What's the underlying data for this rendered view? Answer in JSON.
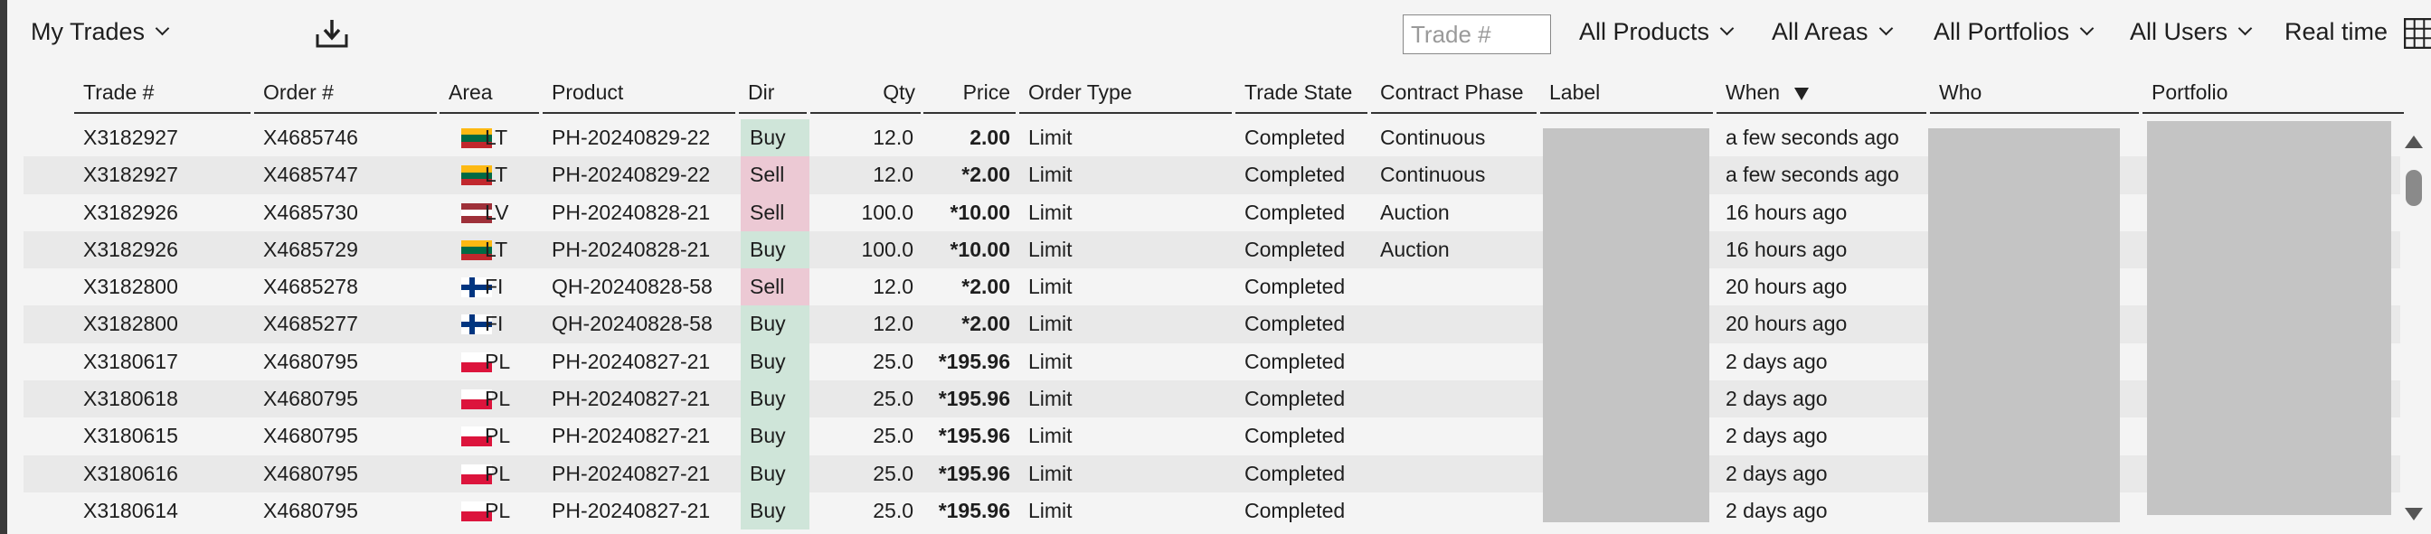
{
  "toolbar": {
    "title": "My Trades",
    "download_icon": "download-icon",
    "search_placeholder": "Trade #",
    "filters": [
      "All Products",
      "All Areas",
      "All Portfolios",
      "All Users"
    ],
    "realtime_label": "Real time",
    "grid_icon": "grid-settings-icon"
  },
  "columns": [
    "Trade #",
    "Order #",
    "Area",
    "Product",
    "Dir",
    "Qty",
    "Price",
    "Order Type",
    "Trade State",
    "Contract Phase",
    "Label",
    "When",
    "Who",
    "Portfolio"
  ],
  "sorted_column": "When",
  "sort_direction": "descending",
  "colors": {
    "buy_bg": "#cfe5d9",
    "sell_bg": "#ecc9d4",
    "header_rule": "#333333"
  },
  "flags": {
    "LT": [
      "#fdb913",
      "#006a44",
      "#c1272d"
    ],
    "LV": [
      "#9e3039",
      "#ffffff",
      "#9e3039"
    ],
    "FI": "white-with-blue-cross",
    "PL": [
      "#ffffff",
      "#dc143c"
    ]
  },
  "rows": [
    {
      "trade": "X3182927",
      "order": "X4685746",
      "area": "LT",
      "product": "PH-20240829-22",
      "dir": "Buy",
      "qty": "12.0",
      "price": "2.00",
      "order_type": "Limit",
      "state": "Completed",
      "phase": "Continuous",
      "when": "a few seconds ago"
    },
    {
      "trade": "X3182927",
      "order": "X4685747",
      "area": "LT",
      "product": "PH-20240829-22",
      "dir": "Sell",
      "qty": "12.0",
      "price": "*2.00",
      "order_type": "Limit",
      "state": "Completed",
      "phase": "Continuous",
      "when": "a few seconds ago"
    },
    {
      "trade": "X3182926",
      "order": "X4685730",
      "area": "LV",
      "product": "PH-20240828-21",
      "dir": "Sell",
      "qty": "100.0",
      "price": "*10.00",
      "order_type": "Limit",
      "state": "Completed",
      "phase": "Auction",
      "when": "16 hours ago"
    },
    {
      "trade": "X3182926",
      "order": "X4685729",
      "area": "LT",
      "product": "PH-20240828-21",
      "dir": "Buy",
      "qty": "100.0",
      "price": "*10.00",
      "order_type": "Limit",
      "state": "Completed",
      "phase": "Auction",
      "when": "16 hours ago"
    },
    {
      "trade": "X3182800",
      "order": "X4685278",
      "area": "FI",
      "product": "QH-20240828-58",
      "dir": "Sell",
      "qty": "12.0",
      "price": "*2.00",
      "order_type": "Limit",
      "state": "Completed",
      "phase": "",
      "when": "20 hours ago"
    },
    {
      "trade": "X3182800",
      "order": "X4685277",
      "area": "FI",
      "product": "QH-20240828-58",
      "dir": "Buy",
      "qty": "12.0",
      "price": "*2.00",
      "order_type": "Limit",
      "state": "Completed",
      "phase": "",
      "when": "20 hours ago"
    },
    {
      "trade": "X3180617",
      "order": "X4680795",
      "area": "PL",
      "product": "PH-20240827-21",
      "dir": "Buy",
      "qty": "25.0",
      "price": "*195.96",
      "order_type": "Limit",
      "state": "Completed",
      "phase": "",
      "when": "2 days ago"
    },
    {
      "trade": "X3180618",
      "order": "X4680795",
      "area": "PL",
      "product": "PH-20240827-21",
      "dir": "Buy",
      "qty": "25.0",
      "price": "*195.96",
      "order_type": "Limit",
      "state": "Completed",
      "phase": "",
      "when": "2 days ago"
    },
    {
      "trade": "X3180615",
      "order": "X4680795",
      "area": "PL",
      "product": "PH-20240827-21",
      "dir": "Buy",
      "qty": "25.0",
      "price": "*195.96",
      "order_type": "Limit",
      "state": "Completed",
      "phase": "",
      "when": "2 days ago"
    },
    {
      "trade": "X3180616",
      "order": "X4680795",
      "area": "PL",
      "product": "PH-20240827-21",
      "dir": "Buy",
      "qty": "25.0",
      "price": "*195.96",
      "order_type": "Limit",
      "state": "Completed",
      "phase": "",
      "when": "2 days ago"
    },
    {
      "trade": "X3180614",
      "order": "X4680795",
      "area": "PL",
      "product": "PH-20240827-21",
      "dir": "Buy",
      "qty": "25.0",
      "price": "*195.96",
      "order_type": "Limit",
      "state": "Completed",
      "phase": "",
      "when": "2 days ago"
    }
  ]
}
